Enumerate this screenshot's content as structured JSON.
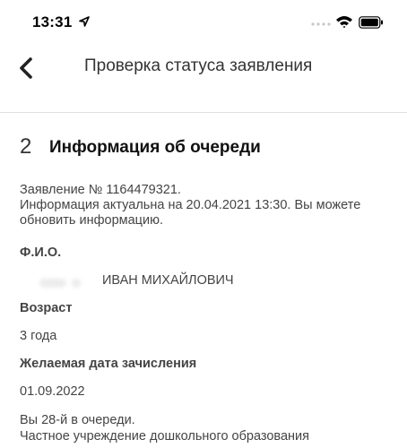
{
  "status_bar": {
    "time": "13:31"
  },
  "nav": {
    "title": "Проверка статуса заявления"
  },
  "section": {
    "step": "2",
    "title": "Информация об очереди"
  },
  "info": {
    "line1": "Заявление № 1164479321.",
    "line2": "Информация актуальна на 20.04.2021 13:30. Вы можете",
    "line3": "обновить информацию."
  },
  "fields": {
    "fio_label": "Ф.И.О.",
    "fio_value": "ИВАН МИХАЙЛОВИЧ",
    "age_label": "Возраст",
    "age_value": "3 года",
    "date_label": "Желаемая дата зачисления",
    "date_value": "01.09.2022"
  },
  "queue": {
    "position": "Вы 28-й в очереди.",
    "institution": "Частное учреждение дошкольного образования"
  }
}
